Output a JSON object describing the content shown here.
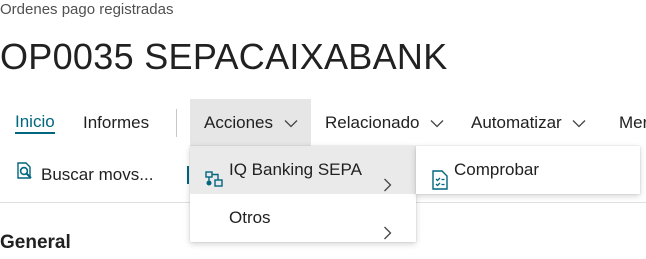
{
  "header": {
    "breadcrumb": "Ordenes pago registradas",
    "title": "OP0035 SEPACAIXABANK"
  },
  "tabs": [
    {
      "label": "Inicio",
      "active": true
    },
    {
      "label": "Informes"
    },
    {
      "label": "Acciones",
      "open": true
    },
    {
      "label": "Relacionado"
    },
    {
      "label": "Automatizar"
    },
    {
      "label": "Mer"
    }
  ],
  "toolbar": {
    "buscar_label": "Buscar movs...",
    "buscar_icon": "search-document-icon"
  },
  "actions_menu": {
    "items": [
      {
        "label": "IQ Banking SEPA",
        "icon": "bank-network-icon",
        "has_submenu": true,
        "highlighted": true
      },
      {
        "label": "Otros",
        "has_submenu": true
      }
    ]
  },
  "submenu": {
    "items": [
      {
        "label": "Comprobar",
        "icon": "checklist-document-icon"
      }
    ]
  },
  "sections": {
    "general": "General"
  },
  "colors": {
    "accent": "#00677f",
    "menu_highlight": "#eaeaea",
    "tab_open_bg": "#e6e6e6"
  }
}
